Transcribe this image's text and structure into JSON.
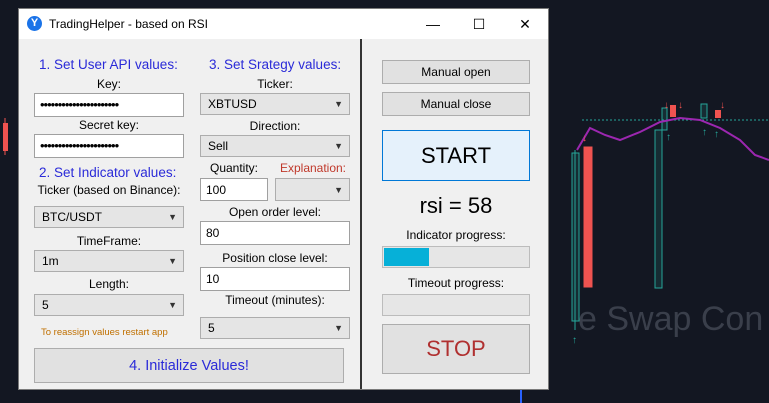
{
  "window": {
    "title": "TradingHelper - based on RSI",
    "app_icon": "Y",
    "minimize_symbol": "—",
    "maximize_symbol": "☐",
    "close_symbol": "✕"
  },
  "api": {
    "header": "1. Set User API values:",
    "key_label": "Key:",
    "key_value": "••••••••••••••••••••••",
    "secret_label": "Secret key:",
    "secret_value": "••••••••••••••••••••••"
  },
  "indicator": {
    "header": "2. Set Indicator values:",
    "ticker_label": "Ticker (based on Binance):",
    "ticker_value": "BTC/USDT",
    "timeframe_label": "TimeFrame:",
    "timeframe_value": "1m",
    "length_label": "Length:",
    "length_value": "5",
    "restart_note": "To reassign values restart app"
  },
  "strategy": {
    "header": "3. Set Srategy values:",
    "ticker_label": "Ticker:",
    "ticker_value": "XBTUSD",
    "direction_label": "Direction:",
    "direction_value": "Sell",
    "quantity_label": "Quantity:",
    "quantity_value": "100",
    "explanation_label": "Explanation:",
    "explanation_value": "",
    "open_level_label": "Open order level:",
    "open_level_value": "80",
    "close_level_label": "Position close level:",
    "close_level_value": "10",
    "timeout_label": "Timeout (minutes):",
    "timeout_value": "5"
  },
  "init_button": "4. Initialize Values!",
  "controls": {
    "manual_open": "Manual open",
    "manual_close": "Manual close",
    "start": "START",
    "rsi_text": "rsi = 58",
    "indicator_progress_label": "Indicator progress:",
    "indicator_progress": 0.32,
    "timeout_progress_label": "Timeout progress:",
    "timeout_progress": 0,
    "stop": "STOP"
  },
  "background": {
    "watermark": "e Swap Con",
    "colors": {
      "up": "#26a69a",
      "down": "#ef5350",
      "rsi_line": "#9c27b0"
    }
  }
}
